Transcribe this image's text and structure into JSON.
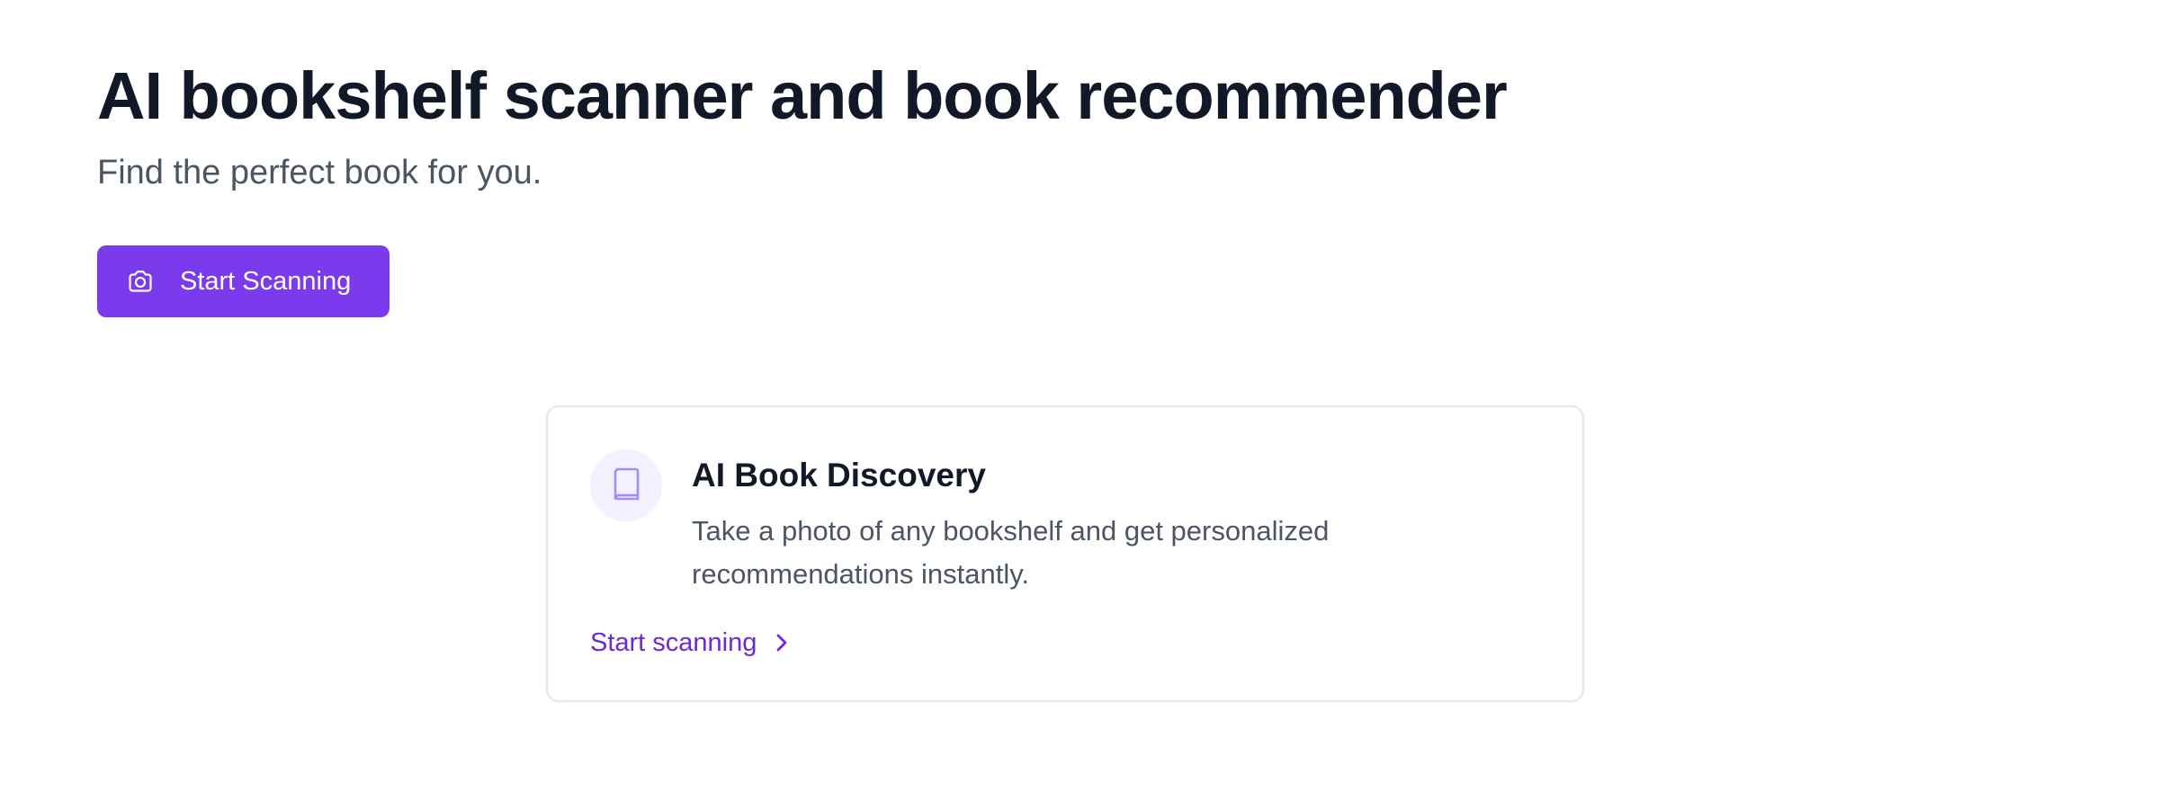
{
  "hero": {
    "title": "AI bookshelf scanner and book recommender",
    "subtitle": "Find the perfect book for you."
  },
  "actions": {
    "start_scanning_button": {
      "label": "Start Scanning",
      "icon": "camera-icon",
      "background_color": "#7c3aed",
      "text_color": "#ffffff"
    }
  },
  "feature_card": {
    "icon": "book-icon",
    "title": "AI Book Discovery",
    "description": "Take a photo of any bookshelf and get personalized recommendations instantly.",
    "link": {
      "label": "Start scanning",
      "icon": "chevron-right-icon",
      "color": "#6d28d9"
    }
  }
}
